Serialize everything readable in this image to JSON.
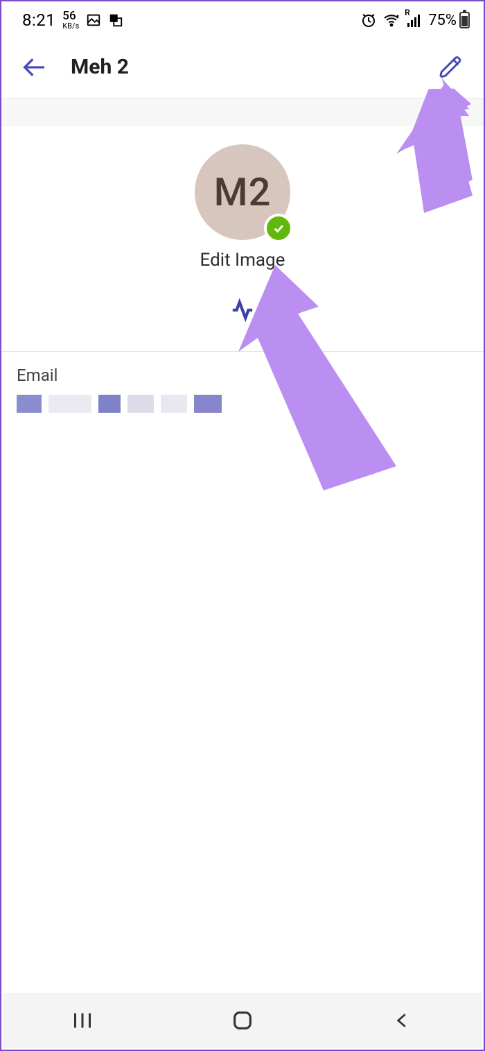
{
  "status_bar": {
    "time": "8:21",
    "net_speed_value": "56",
    "net_speed_unit": "KB/s",
    "battery_percent": "75%",
    "signal_label": "R"
  },
  "header": {
    "title": "Meh 2"
  },
  "profile": {
    "avatar_initials": "M2",
    "edit_image_label": "Edit Image"
  },
  "email_section": {
    "label": "Email"
  },
  "colors": {
    "accent": "#4a4ab9",
    "arrow": "#bb8ef1",
    "presence": "#61b70b"
  }
}
